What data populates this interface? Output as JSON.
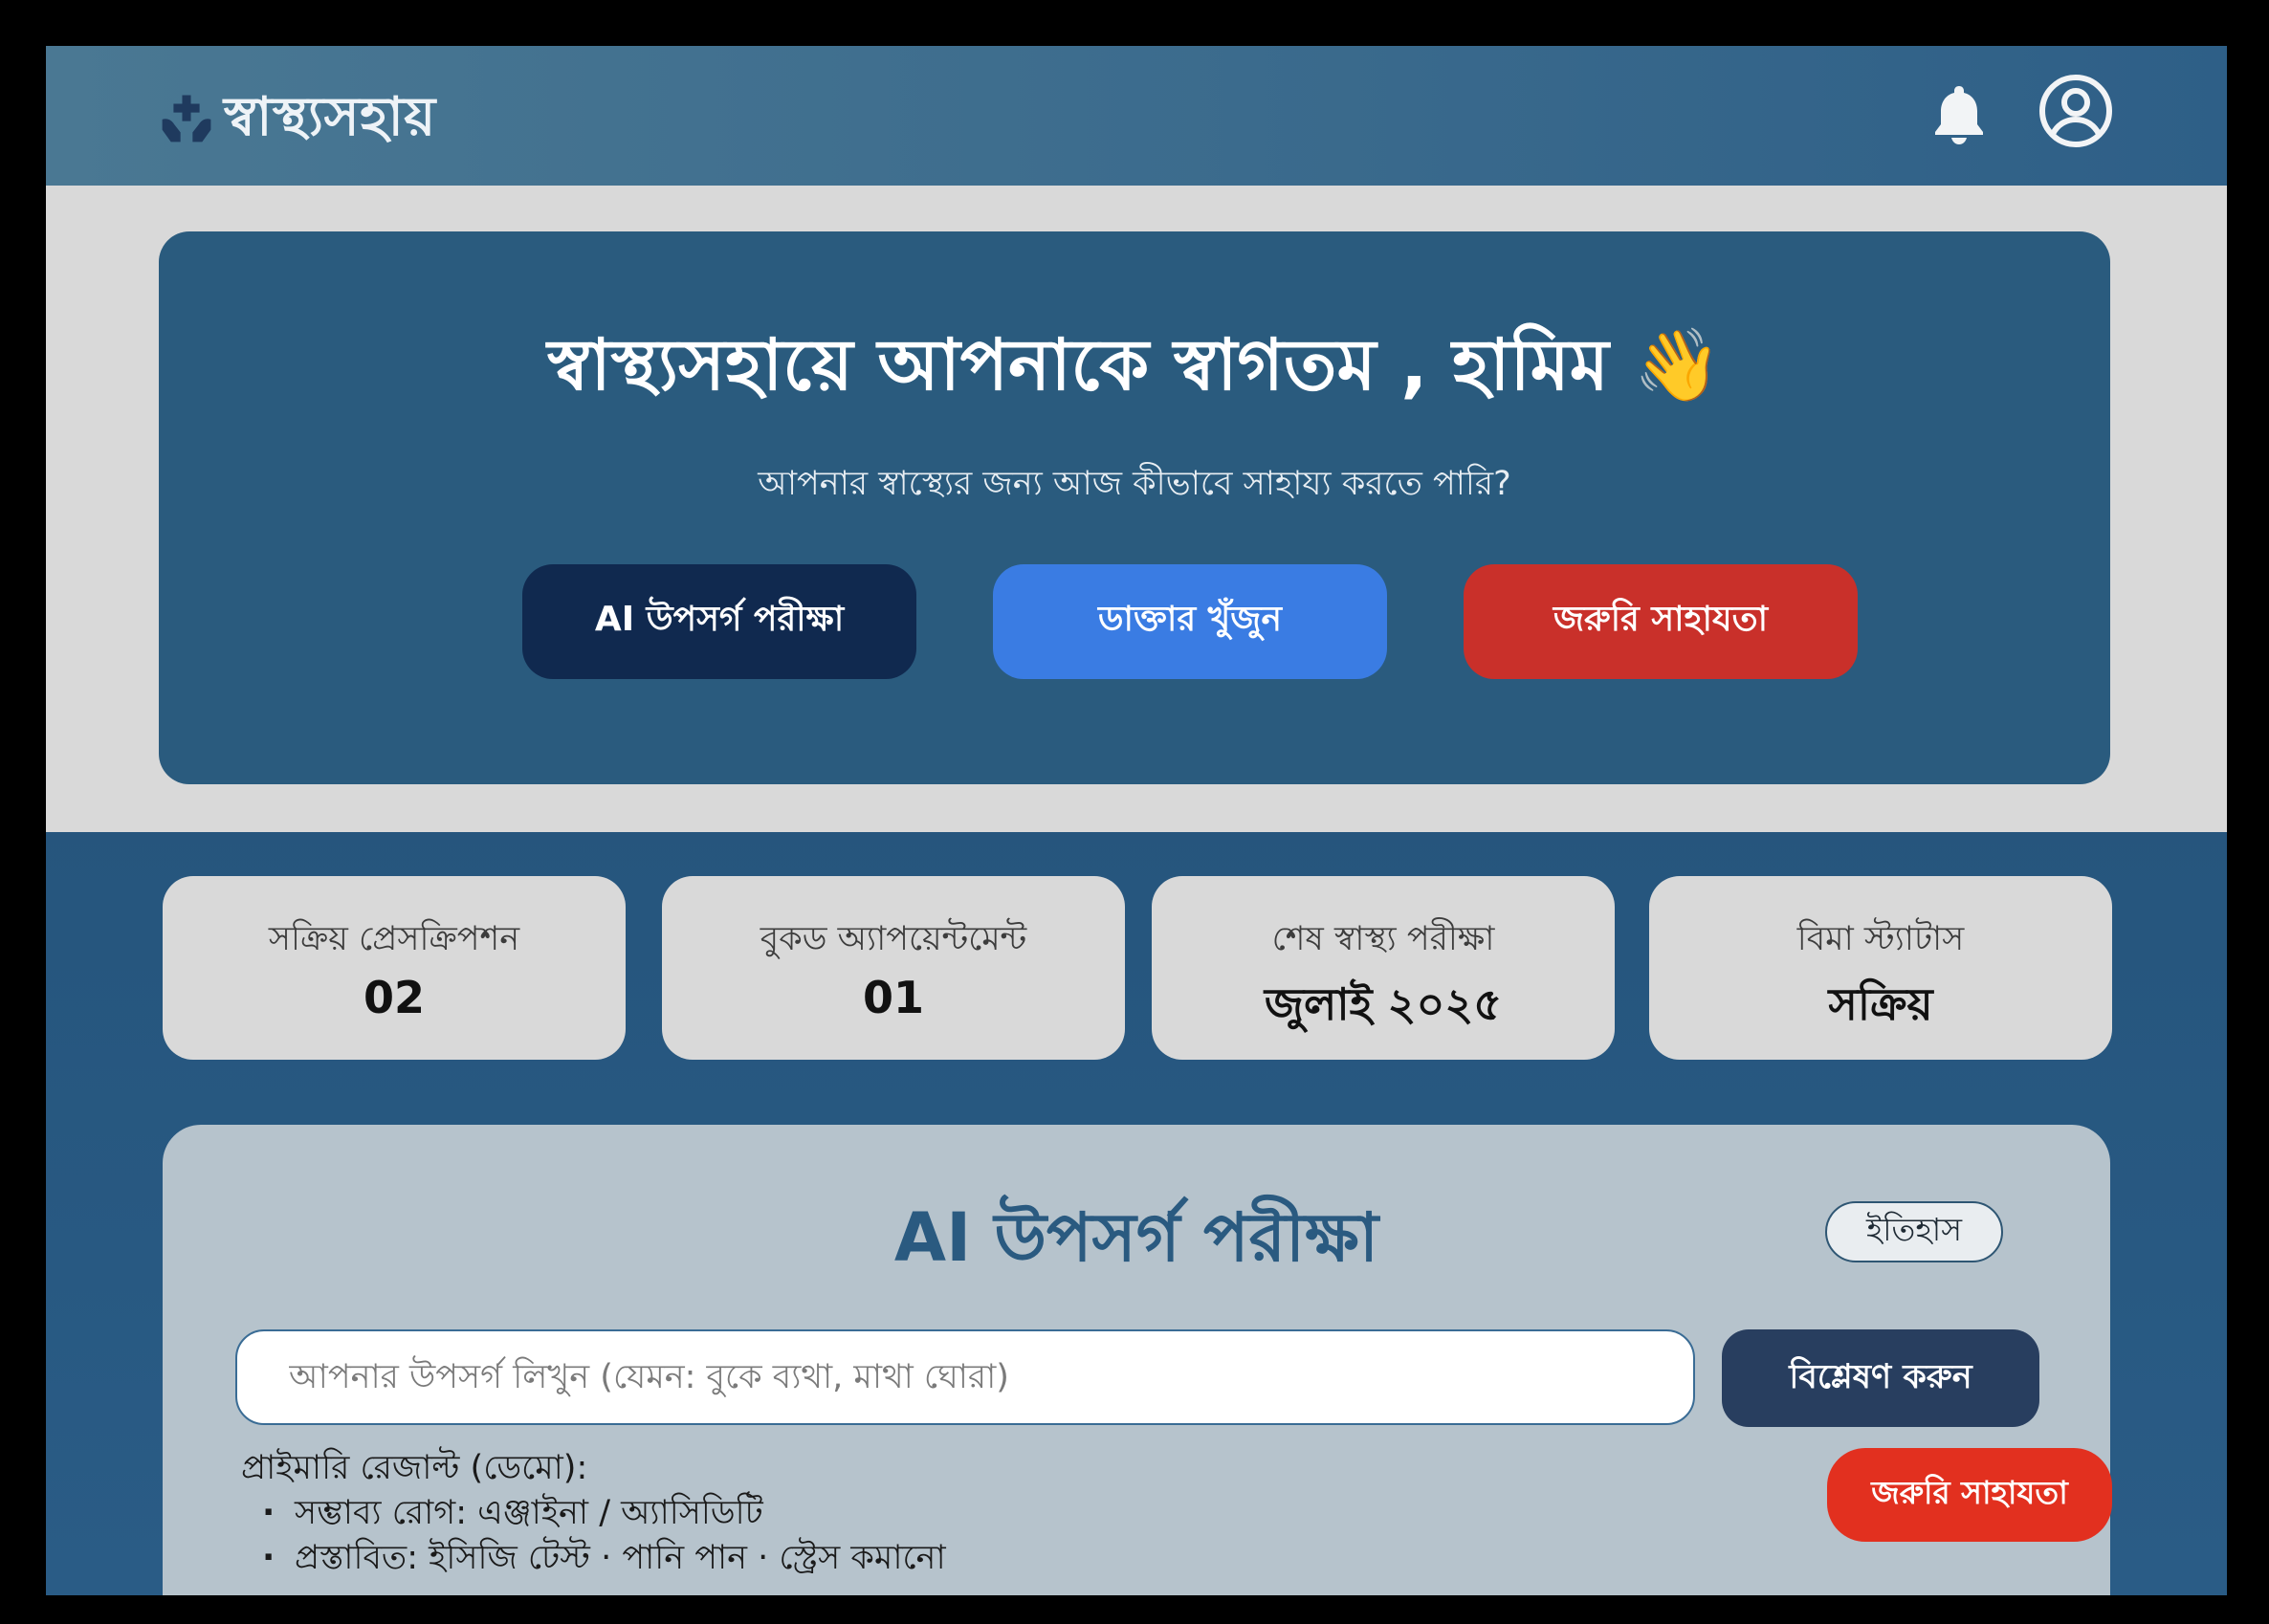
{
  "header": {
    "brand_name": "স্বাস্থ্যসহায়",
    "brand_icon": "health-hands-icon",
    "notification_icon": "bell-icon",
    "profile_icon": "user-circle-icon"
  },
  "hero": {
    "title": "স্বাস্থ্যসহায়ে আপনাকে স্বাগতম , হামিম 👋",
    "subtitle": "আপনার স্বাস্থ্যের জন্য আজ কীভাবে সাহায্য করতে পারি?",
    "buttons": {
      "ai_check": "AI উপসর্গ পরীক্ষা",
      "find_doctor": "ডাক্তার খুঁজুন",
      "emergency": "জরুরি সাহাযতা"
    }
  },
  "stats": [
    {
      "label": "সক্রিয় প্রেসক্রিপশন",
      "value": "02"
    },
    {
      "label": "বুকড অ্যাপয়েন্টমেন্ট",
      "value": "01"
    },
    {
      "label": "শেষ স্বাস্থ্য পরীক্ষা",
      "value": "জুলাই ২০২৫"
    },
    {
      "label": "বিমা স্ট্যাটাস",
      "value": "সক্রিয়"
    }
  ],
  "symptom_checker": {
    "title": "AI উপসর্গ পরীক্ষা",
    "history_label": "ইতিহাস",
    "input_placeholder": "আপনার উপসর্গ লিখুন (যেমন: বুকে ব্যথা, মাথা ঘোরা)",
    "input_value": "",
    "analyze_label": "বিশ্লেষণ করুন",
    "result_heading": "প্রাইমারি রেজাল্ট (ডেমো):",
    "result_items": [
      "সম্ভাব্য রোগ: এঞ্জাইনা / অ্যাসিডিটি",
      "প্রস্তাবিত: ইসিজি টেস্ট · পানি পান · স্ট্রেস কমানো"
    ]
  },
  "floating": {
    "emergency_label": "জরুরি সাহাযতা"
  },
  "colors": {
    "header_bg": "#3b6b8d",
    "hero_bg": "#2a5b7e",
    "ai_button": "#10294f",
    "doctor_button": "#3a7ce3",
    "emergency_button": "#c9302a",
    "panel_bg": "#b6c3cc",
    "panel_title": "#2a5a80"
  }
}
